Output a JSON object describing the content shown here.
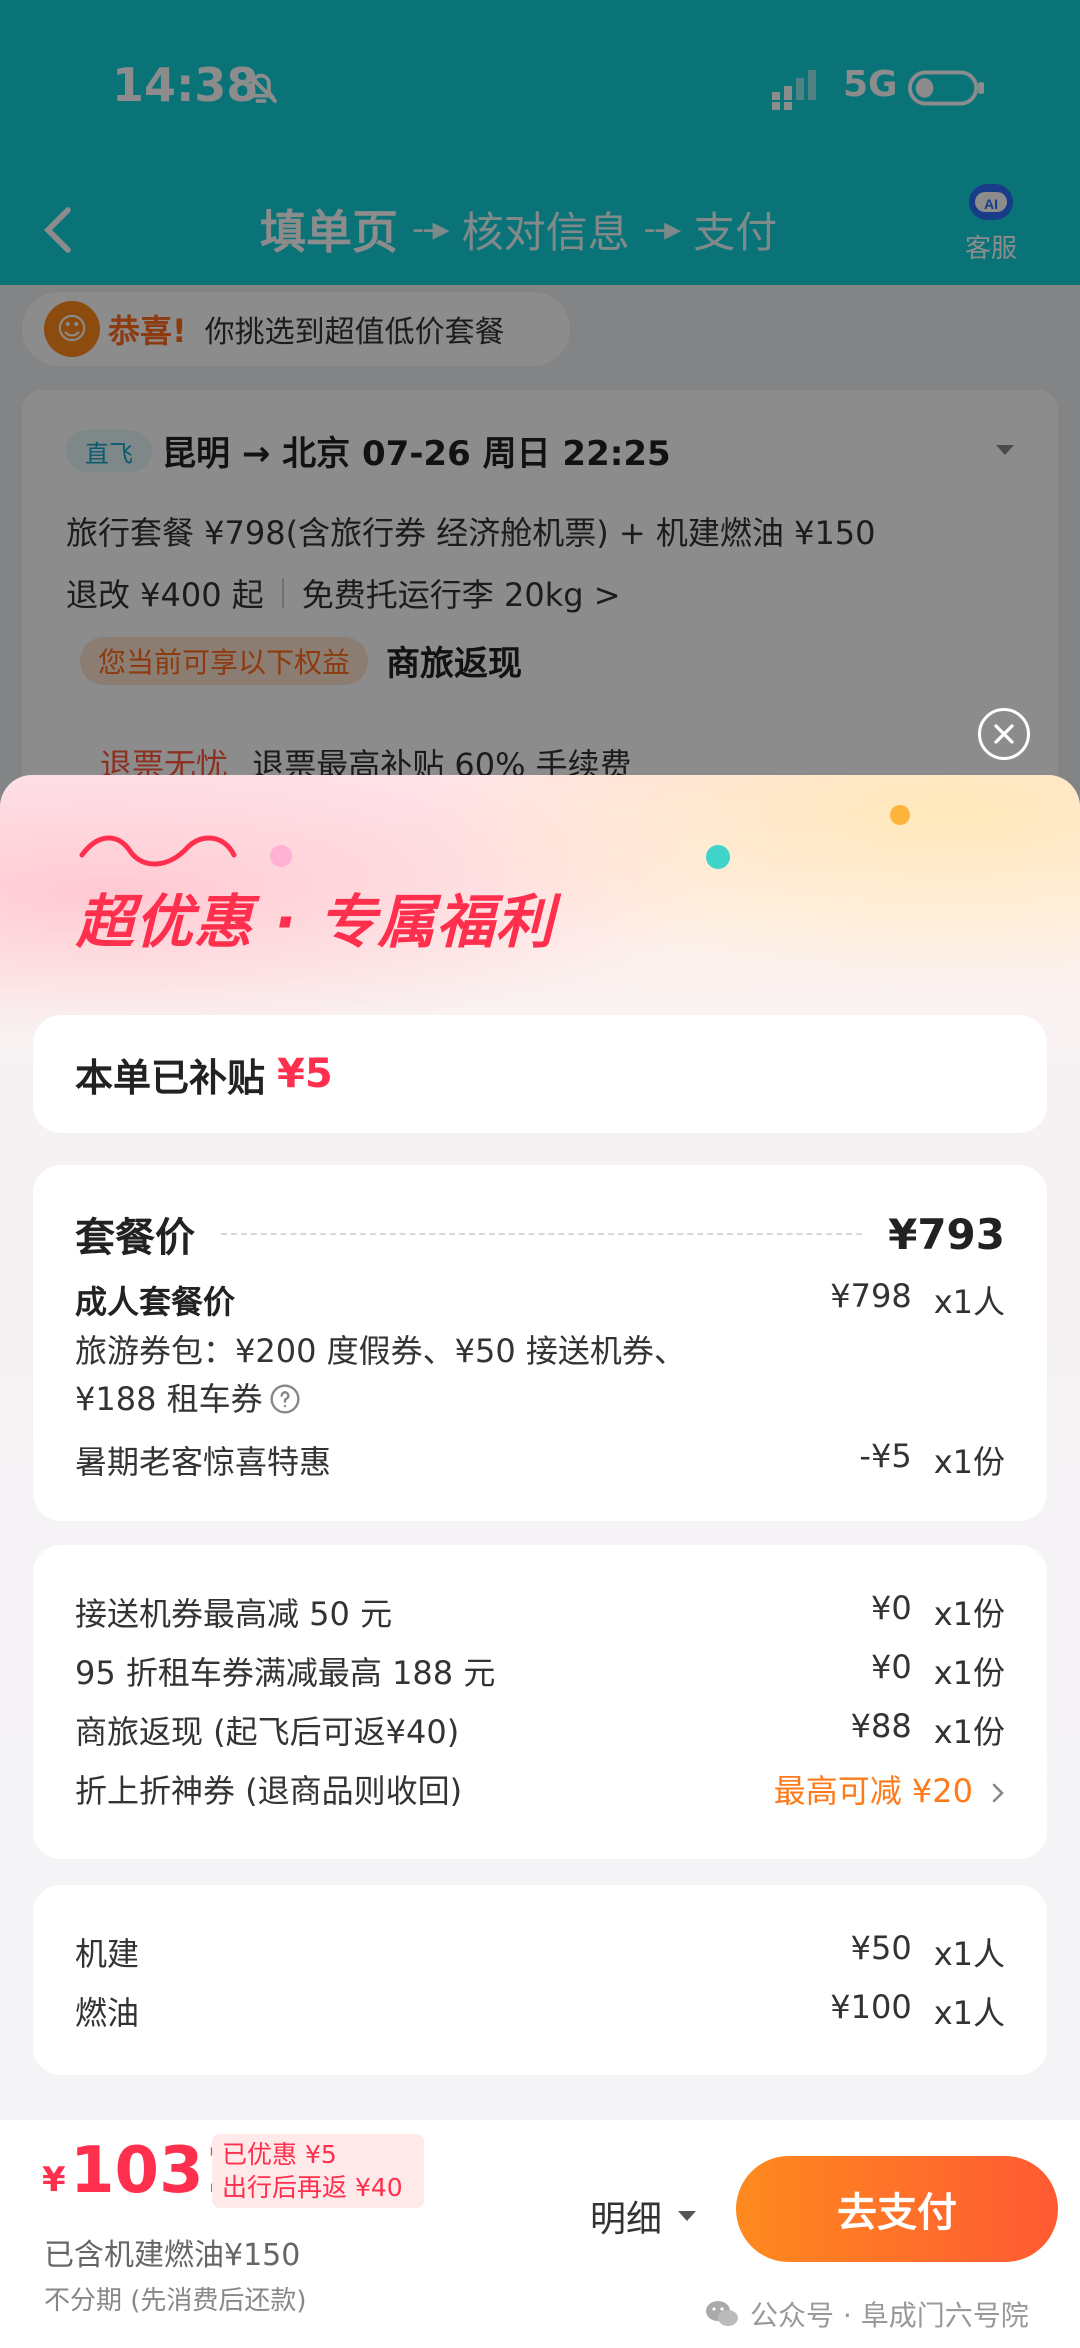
{
  "status_bar": {
    "time": "14:38",
    "network": "5G"
  },
  "nav": {
    "steps": [
      "填单页",
      "核对信息",
      "支付"
    ],
    "arrow": "--▸",
    "service_label": "客服",
    "service_badge": "AI"
  },
  "banner": {
    "title": "恭喜!",
    "text": "你挑选到超值低价套餐"
  },
  "flight": {
    "tag": "直飞",
    "route": "昆明 → 北京  07-26  周日  22:25",
    "price_line": "旅行套餐 ¥798(含旅行券 经济舱机票) + 机建燃油 ¥150",
    "refund": "退改 ¥400 起",
    "baggage": "免费托运行李 20kg >",
    "benefit_tag": "您当前可享以下权益",
    "benefit_name": "商旅返现",
    "insurance_title": "退票无忧",
    "insurance_text": "退票最高补贴 60% 手续费"
  },
  "sheet": {
    "title": "超优惠 · 专属福利",
    "subsidy_label": "本单已补贴",
    "subsidy_amount": "¥5",
    "package": {
      "title": "套餐价",
      "price": "¥793",
      "adult_label": "成人套餐价",
      "adult_price": "¥798",
      "adult_qty": "x1人",
      "voucher_text": "旅游券包：¥200 度假券、¥50 接送机券、¥188 租车券",
      "promo_label": "暑期老客惊喜特惠",
      "promo_price": "-¥5",
      "promo_qty": "x1份"
    },
    "coupons": [
      {
        "label": "接送机券最高减 50 元",
        "price": "¥0",
        "qty": "x1份"
      },
      {
        "label": "95 折租车券满减最高 188 元",
        "price": "¥0",
        "qty": "x1份"
      },
      {
        "label": "商旅返现 (起飞后可返¥40)",
        "price": "¥88",
        "qty": "x1份"
      },
      {
        "label": "折上折神券 (退商品则收回)",
        "action": "最高可减 ¥20"
      }
    ],
    "fees": [
      {
        "label": "机建",
        "price": "¥50",
        "qty": "x1人"
      },
      {
        "label": "燃油",
        "price": "¥100",
        "qty": "x1人"
      }
    ]
  },
  "footer": {
    "currency": "¥",
    "total": "1031",
    "badge_line1": "已优惠 ¥5",
    "badge_line2": "出行后再返 ¥40",
    "fees_included": "已含机建燃油¥150",
    "installment": "不分期 (先消费后还款)",
    "detail_label": "明细",
    "pay_label": "去支付",
    "watermark": "公众号 · 阜成门六号院"
  },
  "colors": {
    "header": "#13d2da",
    "accent_red": "#ff2f4d",
    "accent_orange": "#ff7a1a"
  },
  "icons": [
    "bell-off-icon",
    "signal-icon",
    "battery-icon",
    "back-arrow-icon",
    "ai-service-icon",
    "close-icon",
    "help-icon",
    "chevron-right-icon",
    "triangle-down-icon",
    "wechat-icon"
  ]
}
